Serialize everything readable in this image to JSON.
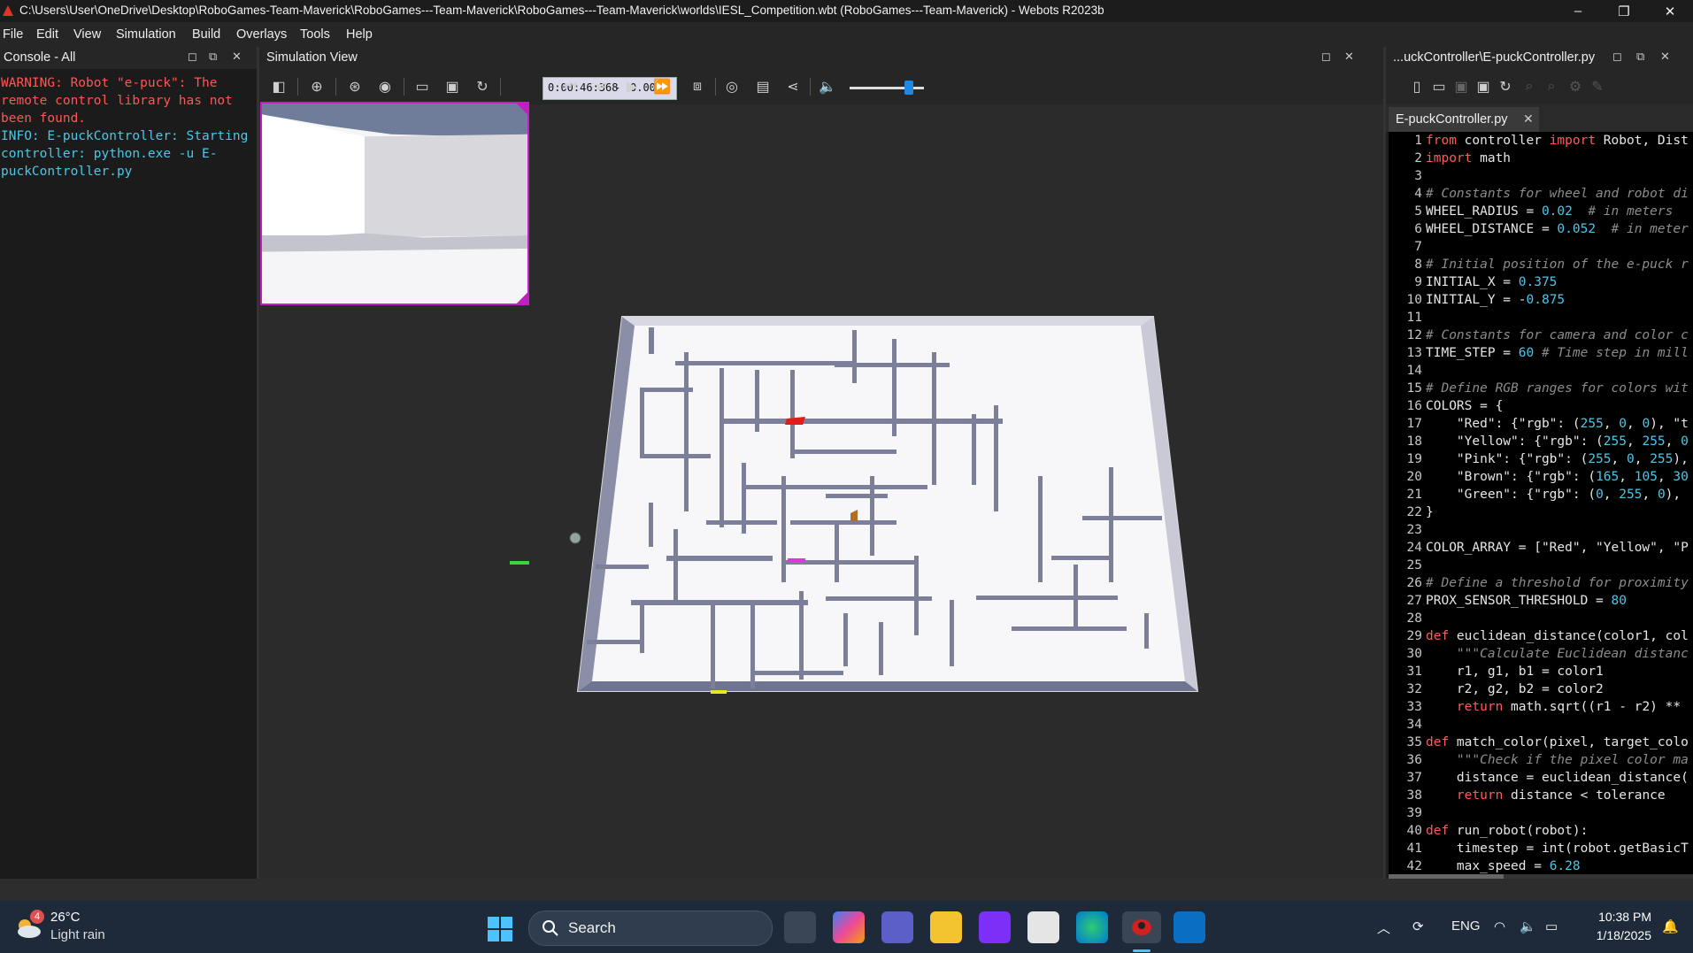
{
  "window": {
    "title": "C:\\Users\\User\\OneDrive\\Desktop\\RoboGames-Team-Maverick\\RoboGames---Team-Maverick\\RoboGames---Team-Maverick\\worlds\\IESL_Competition.wbt (RoboGames---Team-Maverick) - Webots R2023b",
    "minimize": "–",
    "restore": "❐",
    "close": "✕"
  },
  "menu": [
    "File",
    "Edit",
    "View",
    "Simulation",
    "Build",
    "Overlays",
    "Tools",
    "Help"
  ],
  "console": {
    "title": "Console - All",
    "messages": [
      {
        "type": "warning",
        "text": "WARNING: Robot \"e-puck\": The remote control library has not been found."
      },
      {
        "type": "info",
        "text": "INFO: E-puckController: Starting controller: python.exe -u E-puckController.py"
      }
    ]
  },
  "simulation": {
    "title": "Simulation View",
    "time": "0:00:46:368",
    "speed_sep": "-",
    "speed": "0.00x",
    "volume_level": 0.8
  },
  "editor": {
    "title": "...uckController\\E-puckController.py",
    "tab": "E-puckController.py",
    "lines": [
      "from controller import Robot, Dist",
      "import math",
      "",
      "# Constants for wheel and robot di",
      "WHEEL_RADIUS = 0.02  # in meters",
      "WHEEL_DISTANCE = 0.052  # in meter",
      "",
      "# Initial position of the e-puck r",
      "INITIAL_X = 0.375",
      "INITIAL_Y = -0.875",
      "",
      "# Constants for camera and color c",
      "TIME_STEP = 60 # Time step in mill",
      "",
      "# Define RGB ranges for colors wit",
      "COLORS = {",
      "    \"Red\": {\"rgb\": (255, 0, 0), \"t",
      "    \"Yellow\": {\"rgb\": (255, 255, 0",
      "    \"Pink\": {\"rgb\": (255, 0, 255),",
      "    \"Brown\": {\"rgb\": (165, 105, 30",
      "    \"Green\": {\"rgb\": (0, 255, 0),",
      "}",
      "",
      "COLOR_ARRAY = [\"Red\", \"Yellow\", \"P",
      "",
      "# Define a threshold for proximity",
      "PROX_SENSOR_THRESHOLD = 80",
      "",
      "def euclidean_distance(color1, col",
      "    \"\"\"Calculate Euclidean distanc",
      "    r1, g1, b1 = color1",
      "    r2, g2, b2 = color2",
      "    return math.sqrt((r1 - r2) ** ",
      "",
      "def match_color(pixel, target_colo",
      "    \"\"\"Check if the pixel color ma",
      "    distance = euclidean_distance(",
      "    return distance < tolerance",
      "",
      "def run_robot(robot):",
      "    timestep = int(robot.getBasicT",
      "    max_speed = 6.28"
    ]
  },
  "taskbar": {
    "weather_badge": "4",
    "temperature": "26°C",
    "weather": "Light rain",
    "search": "Search",
    "language": "ENG",
    "time": "10:38 PM",
    "date": "1/18/2025"
  }
}
